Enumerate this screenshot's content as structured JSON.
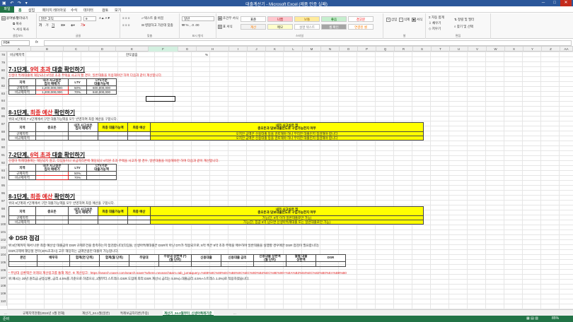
{
  "window": {
    "title": "대출계산기 - Microsoft Excel (제품 인증 실패)",
    "qa": "▣ ↶ ↷ ▾"
  },
  "ribbon_tabs": [
    "파일",
    "홈",
    "삽입",
    "페이지 레이아웃",
    "수식",
    "데이터",
    "검토",
    "보기"
  ],
  "ribbon": {
    "clipboard": {
      "paste": "붙여넣기",
      "cut": "잘라내기",
      "copy": "복사",
      "format_painter": "서식 복사",
      "label": "클립보드"
    },
    "font": {
      "name": "맑은 고딕",
      "size": "9",
      "label": "글꼴"
    },
    "alignment": {
      "wrap": "텍스트 줄 바꿈",
      "merge": "병합하고 가운데 맞춤",
      "label": "맞춤"
    },
    "number": {
      "format": "일반",
      "label": "표시 형식"
    },
    "styles": {
      "conditional": "조건부 서식",
      "table": "표 서식",
      "label": "스타일",
      "cells": [
        {
          "text": "표준",
          "bg": "#ffffff",
          "fg": "#000000"
        },
        {
          "text": "나쁨",
          "bg": "#ffc7ce",
          "fg": "#9c0006"
        },
        {
          "text": "보통",
          "bg": "#ffeb9c",
          "fg": "#9c6500"
        },
        {
          "text": "좋음",
          "bg": "#c6efce",
          "fg": "#006100"
        },
        {
          "text": "경고문",
          "bg": "#ffffff",
          "fg": "#ff0000"
        },
        {
          "text": "계산",
          "bg": "#f2f2f2",
          "fg": "#fa7d00"
        },
        {
          "text": "메모",
          "bg": "#ffffcc",
          "fg": "#333333"
        },
        {
          "text": "설명 텍스트",
          "bg": "#ffffff",
          "fg": "#7f7f7f"
        },
        {
          "text": "셀 확인",
          "bg": "#a5a5a5",
          "fg": "#ffffff"
        },
        {
          "text": "연결된 셀",
          "bg": "#ffffff",
          "fg": "#fa7d00"
        }
      ]
    },
    "cells": {
      "insert": "삽입",
      "delete": "삭제",
      "format": "서식",
      "label": "셀"
    },
    "editing": {
      "autosum": "자동 합계",
      "fill": "채우기",
      "clear": "지우기",
      "sort": "정렬 및 필터",
      "find": "찾기 및 선택",
      "label": "편집"
    }
  },
  "formula_bar": {
    "name_box": "F84",
    "fx": "fx",
    "value": ""
  },
  "columns": [
    "A",
    "B",
    "C",
    "D",
    "E",
    "F",
    "G",
    "H",
    "I",
    "J",
    "K",
    "L",
    "M",
    "N",
    "O",
    "P",
    "Q",
    "R",
    "S",
    "T",
    "U",
    "V",
    "W",
    "X",
    "Y",
    "Z",
    "AA",
    "AB",
    "AC",
    "AD"
  ],
  "rows": [
    "78",
    "79",
    "80",
    "81",
    "82",
    "83",
    "84",
    "85",
    "86",
    "87",
    "88",
    "89",
    "90",
    "91",
    "92",
    "93",
    "94",
    "95",
    "96",
    "97",
    "98",
    "99",
    "100",
    "101",
    "102",
    "103",
    "104",
    "105",
    "106",
    "107",
    "108",
    "109",
    "110",
    "111"
  ],
  "sheet": {
    "r78": {
      "a": "비규제지역",
      "e": "한도없음",
      "h": "%"
    },
    "s7_1": {
      "title_pre": "7-1단계. ",
      "title_red": "9억 초과",
      "title_post": " 대출 확인하기",
      "note": "신생아 특례대출에 해당되나 9억원 초과 주택을 사고자 할 경우, 일반대출을 이용해야만 하며 다음과 같이 계산합니다.",
      "headers": [
        "지역",
        "내가 사고싶은\n집의 매매가",
        "LTV",
        "LTV기준\n대출가능액"
      ],
      "rows": [
        [
          "규제지역",
          "1,200,000,000",
          "50%",
          "600,000,000"
        ],
        [
          "비규제지역",
          "1,200,000,000",
          "70%",
          "840,000,000"
        ]
      ]
    },
    "s8_1a": {
      "title_pre": "8-1단계, ",
      "title_red": "최종 예산",
      "title_post": " 확인하기",
      "note": "위의 6단계와 7-1단계에서 구한 대출가능액을 모두 반영하여 최종 예산을 구합니다.",
      "headers": [
        "지역",
        "총오돈",
        "내가 사고싶은\n집의 매매가",
        "최종 대출가능액",
        "최종 예산",
        "내가 사고싶은 집\n총오돈과 담보대출한도로 구입가능한지 여부"
      ],
      "lines": [
        "오지안 금액은 신용대출 등을 검토해야 하나 무리한 대출인지 점검해야 합니다",
        "오지안 금액은 신용대출 등을 검토해야 하나 무리한 대출인지 점검해야 합니다"
      ],
      "rows": [
        "규제지역",
        "비규제지역"
      ]
    },
    "s7_2": {
      "title_pre": "7-2단계, ",
      "title_red": "6억 초과",
      "title_post": " 대출 확인하기",
      "note": "신생아 특례대출에는 해당되지 않고, 디딤돌이나 보금자리론에 해당되나 6억원 초과 주택을 사고자 할 경우, 일반대출을 이용해야만 하며 다음과 같이 계산합니다.",
      "headers": [
        "지역",
        "내가 사고싶은\n집의 매매가",
        "LTV",
        "LTV기준\n대출가능액"
      ],
      "rows": [
        [
          "규제지역",
          "",
          "50%",
          ""
        ],
        [
          "비규제지역",
          "",
          "70%",
          ""
        ]
      ]
    },
    "s8_1b": {
      "title_pre": "8-1단계, ",
      "title_red": "최종 예산",
      "title_post": " 확인하기",
      "note": "위의 6단계와 7단계에서 구한 대출가능액을 모두 반영하여 최종 예산을 구합니다.",
      "headers": [
        "지역",
        "총오돈",
        "내가 사고싶은\n집의 매매가",
        "최종 대출가능액",
        "최종 예산",
        "내가 사고싶은 집\n총오돈과 담보대출한도로 구입가능한지 여부"
      ],
      "lines": [
        "가능(단, 6억 이하 일반대출로만 가능)",
        "가능(단, 집값 6억 넘으면 신생아특례대출 또는 일반대출로만 가능)"
      ],
      "rows": [
        "규제지역",
        "비규제지역"
      ]
    },
    "dsr": {
      "title": "※ DSR 점검",
      "note1": "위 8단계까지 해서 나온 최종 예산상 대출금이 DSR 규제조건을 충족하는지 점검합니다(디딤돌, 신생아특례대출은 DSR이 아닌 DTI가 적용되므로, 6억 혹은 9억 초과 주택을 매수하며 일반대출을 실행할 경우에만 DSR 점검이 필요합니다)",
      "note2": "DSR규제에 해당될 경우(40%초과시) 고르 해당하는 금액만큼만 대출이 가능합니다.",
      "headers": [
        "본인",
        "배우자",
        "합계(연 단위)",
        "합계(월 단위)",
        "주담대",
        "주담대 상환액 (*)\n(월 단위)",
        "신용대출",
        "신용대출 금리",
        "신용대출 상환액\n(월 단위)",
        "월별 대출\n상환액",
        "DSR"
      ],
      "red_note": "* 주담대 상환액은 아래의 계산링크를 통해 계산. ※ 계산링크 : https://search.naver.com/search.naver?where=nexearch&sm=tab_jum&query=%EB%8C%80%EC%B6%9C%EC%9D%B4%EC%9E%90+%EA%B3%84%EC%82%B0%EA%B8%B0",
      "note3": "위 예시는 30년 원리금 균등상환, 금리 4.5%를 기준으로 하였으나, 2월부터 스트레스 DSR 도입에 따라 DSR 계산시 금리는 5.5%(=대출금리 4.5%+스트레스 1.0%)로 적용하였습니다."
    }
  },
  "sheet_tabs": [
    "...",
    "규제지역현황(2024년 1월 현재)",
    "계산기_24.1월(일반)",
    "특례보금자리론(주중)",
    "계산기_24.2월부터_신생아특례기준",
    "..."
  ],
  "status": {
    "left": "준비",
    "zoom": "85%"
  }
}
